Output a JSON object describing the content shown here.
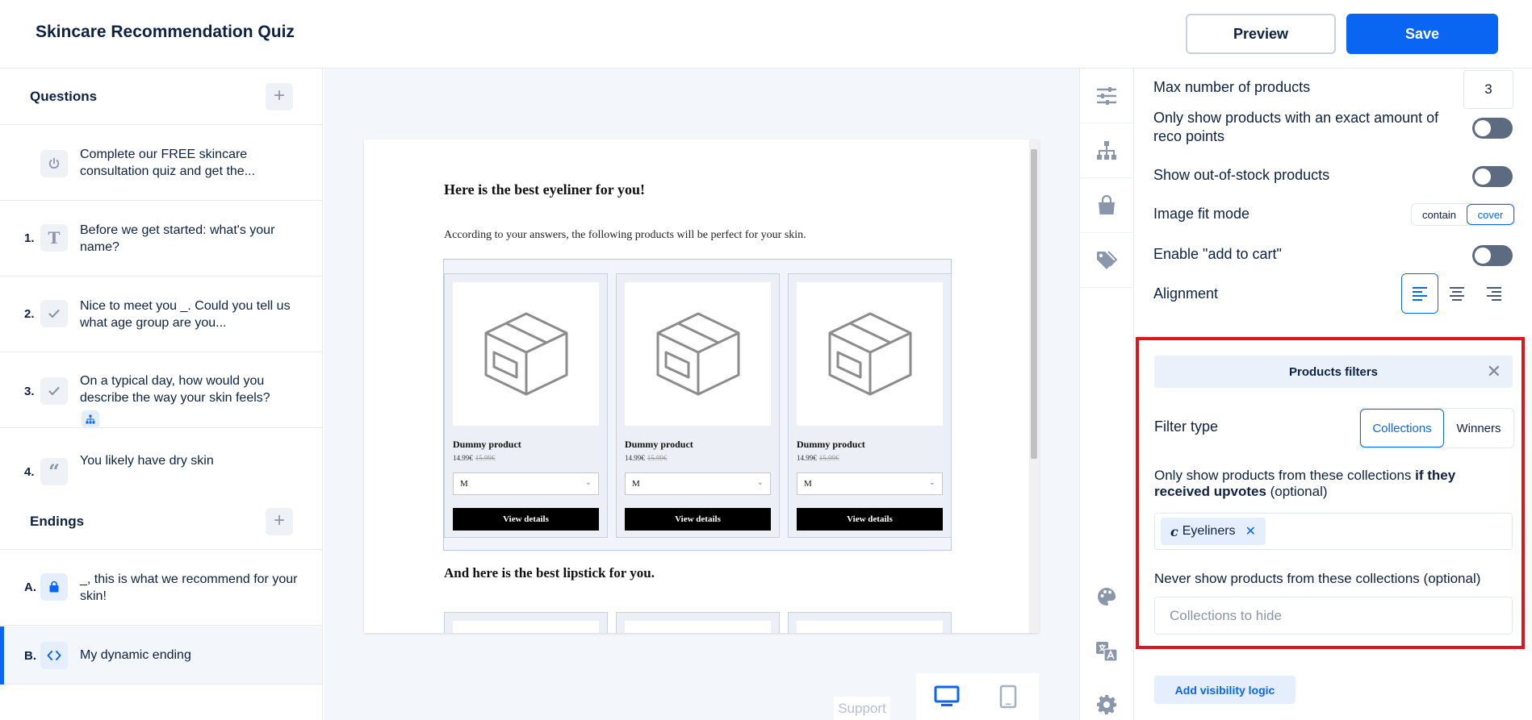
{
  "header": {
    "title": "Skincare Recommendation Quiz",
    "preview_label": "Preview",
    "save_label": "Save"
  },
  "sidebar": {
    "questions_title": "Questions",
    "endings_title": "Endings",
    "add_symbol": "+",
    "intro": {
      "text": "Complete our FREE skincare consultation quiz and get the...",
      "icon": "power-icon"
    },
    "questions": [
      {
        "num": "1.",
        "text": "Before we get started: what's your name?",
        "icon": "text-T-icon"
      },
      {
        "num": "2.",
        "text": "Nice to meet you _. Could you tell us what age group are you...",
        "icon": "check-icon"
      },
      {
        "num": "3.",
        "text": "On a typical day, how would you describe the way your skin feels?",
        "icon": "check-icon"
      },
      {
        "num": "4.",
        "text": "You likely have dry skin",
        "icon": "quote-icon"
      }
    ],
    "endings": [
      {
        "num": "A.",
        "text": "_, this is what we recommend for your skin!",
        "icon": "shopping-bag-icon"
      },
      {
        "num": "B.",
        "text": "My dynamic ending",
        "icon": "code-icon"
      }
    ]
  },
  "preview": {
    "heading": "Here is the best eyeliner for you!",
    "subtext": "According to your answers, the following products will be perfect for your skin.",
    "products": [
      {
        "name": "Dummy product",
        "price": "14.99€",
        "old_price": "15.99€",
        "variant": "M",
        "button": "View details"
      },
      {
        "name": "Dummy product",
        "price": "14.99€",
        "old_price": "15.99€",
        "variant": "M",
        "button": "View details"
      },
      {
        "name": "Dummy product",
        "price": "14.99€",
        "old_price": "15.99€",
        "variant": "M",
        "button": "View details"
      }
    ],
    "heading2": "And here is the best lipstick for you."
  },
  "canvas": {
    "support_label": "Support"
  },
  "settings": {
    "max_products_label": "Max number of products",
    "max_products_value": "3",
    "exact_points_label": "Only show products with an exact amount of reco points",
    "out_of_stock_label": "Show out-of-stock products",
    "image_fit_label": "Image fit mode",
    "image_fit_options": [
      "contain",
      "cover"
    ],
    "image_fit_selected": "cover",
    "add_to_cart_label": "Enable \"add to cart\"",
    "alignment_label": "Alignment"
  },
  "filters": {
    "title": "Products filters",
    "filter_type_label": "Filter type",
    "filter_type_options": [
      "Collections",
      "Winners"
    ],
    "filter_type_selected": "Collections",
    "show_label_prefix": "Only show products from these collections",
    "show_label_bold": "if they received upvotes",
    "show_label_suffix": "(optional)",
    "show_tags": [
      {
        "icon": "c",
        "label": "Eyeliners"
      }
    ],
    "hide_label": "Never show products from these collections (optional)",
    "hide_placeholder": "Collections to hide",
    "visibility_button": "Add visibility logic"
  },
  "colors": {
    "accent": "#0a66f2",
    "highlight_border": "#e0151b",
    "navy_text": "#0d2242",
    "toggle_off": "#5c6b80"
  }
}
